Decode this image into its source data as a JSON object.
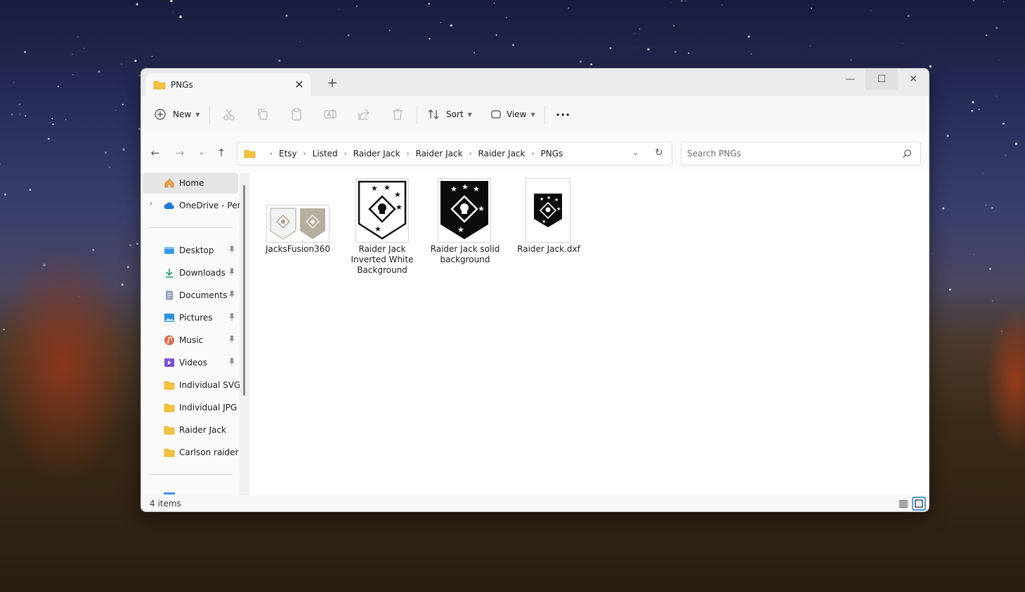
{
  "window": {
    "tab_title": "PNGs",
    "new_tab": "+",
    "close_tab": "✕",
    "controls": {
      "minimize": "—",
      "maximize": "☐",
      "close": "✕"
    }
  },
  "toolbar": {
    "new_label": "New",
    "sort_label": "Sort",
    "view_label": "View",
    "more_label": "···"
  },
  "address": {
    "crumbs": [
      "Etsy",
      "Listed",
      "Raider Jack",
      "Raider Jack",
      "Raider Jack",
      "PNGs"
    ],
    "separator": "›"
  },
  "search": {
    "placeholder": "Search PNGs"
  },
  "sidebar": {
    "home": "Home",
    "onedrive": "OneDrive - Perso",
    "quick_access": [
      {
        "label": "Desktop",
        "pinned": true,
        "icon": "desktop-icon"
      },
      {
        "label": "Downloads",
        "pinned": true,
        "icon": "download-icon"
      },
      {
        "label": "Documents",
        "pinned": true,
        "icon": "documents-icon"
      },
      {
        "label": "Pictures",
        "pinned": true,
        "icon": "pictures-icon"
      },
      {
        "label": "Music",
        "pinned": true,
        "icon": "music-icon"
      },
      {
        "label": "Videos",
        "pinned": true,
        "icon": "videos-icon"
      },
      {
        "label": "Individual SVG",
        "pinned": false,
        "icon": "folder-icon"
      },
      {
        "label": "Individual JPG",
        "pinned": false,
        "icon": "folder-icon"
      },
      {
        "label": "Raider Jack",
        "pinned": false,
        "icon": "folder-icon"
      },
      {
        "label": "Carlson raider",
        "pinned": false,
        "icon": "folder-icon"
      }
    ]
  },
  "files": [
    {
      "name": "JacksFusion360",
      "thumb": "double-shield"
    },
    {
      "name": "Raider Jack Inverted White Background",
      "thumb": "white-shield"
    },
    {
      "name": "Raider Jack solid background",
      "thumb": "black-shield"
    },
    {
      "name": "Raider Jack.dxf",
      "thumb": "small-black-shield"
    }
  ],
  "status": {
    "item_count": "4 items"
  },
  "colors": {
    "accent": "#0067c0",
    "folder": "#f3c33e"
  }
}
